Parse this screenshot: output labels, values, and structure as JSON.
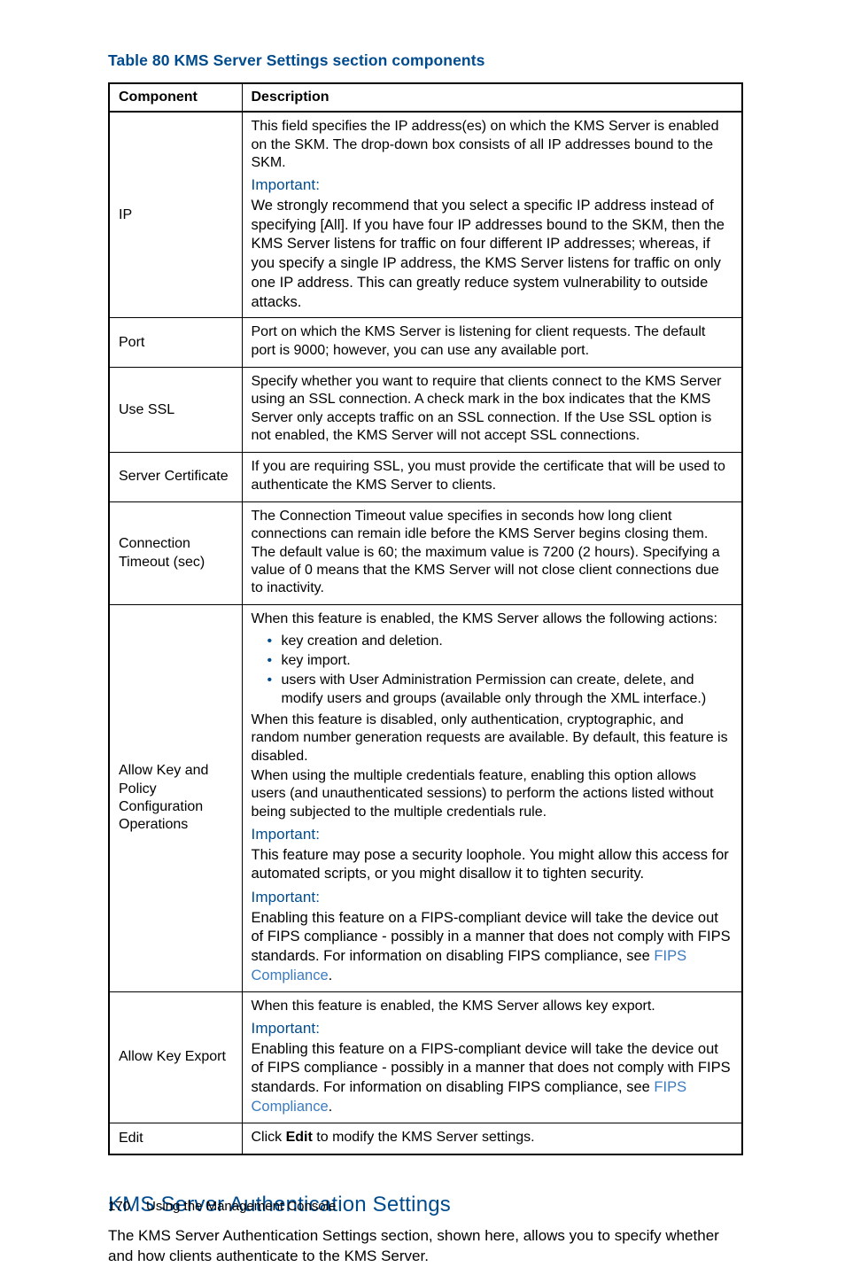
{
  "table_title": "Table 80 KMS Server Settings section components",
  "headers": {
    "c1": "Component",
    "c2": "Description"
  },
  "rows": {
    "ip": {
      "label": "IP",
      "intro": "This field specifies the IP address(es) on which the KMS Server is enabled on the SKM. The drop-down box consists of all IP addresses bound to the SKM.",
      "important": "Important:",
      "body": "We strongly recommend that you select a specific IP address instead of specifying [All]. If you have four IP addresses bound to the SKM, then the KMS Server listens for traffic on four different IP addresses; whereas, if you specify a single IP address, the KMS Server listens for traffic on only one IP address. This can greatly reduce system vulnerability to outside attacks."
    },
    "port": {
      "label": "Port",
      "body": "Port on which the KMS Server is listening for client requests. The default port is 9000; however, you can use any available port."
    },
    "ssl": {
      "label": "Use SSL",
      "body": "Specify whether you want to require that clients connect to the KMS Server using an SSL connection. A check mark in the box indicates that the KMS Server only accepts traffic on an SSL connection. If the Use SSL option is not enabled, the KMS Server will not accept SSL connections."
    },
    "cert": {
      "label": "Server Certificate",
      "body": "If you are requiring SSL, you must provide the certificate that will be used to authenticate the KMS Server to clients."
    },
    "timeout": {
      "label": "Connection Timeout (sec)",
      "body": "The Connection Timeout value specifies in seconds how long client connections can remain idle before the KMS Server begins closing them. The default value is 60; the maximum value is 7200 (2 hours). Specifying a value of 0 means that the KMS Server will not close client connections due to inactivity."
    },
    "allow_kp": {
      "label": "Allow Key and Policy Configuration Operations",
      "intro": "When this feature is enabled, the KMS Server allows the following actions:",
      "li1": "key creation and deletion.",
      "li2": "key import.",
      "li3": "users with User Administration Permission can create, delete, and modify users and groups (available only through the XML interface.)",
      "p2": "When this feature is disabled, only authentication, cryptographic, and random number generation requests are available. By default, this feature is disabled.",
      "p3": "When using the multiple credentials feature, enabling this option allows users (and unauthenticated sessions) to perform the actions listed without being subjected to the multiple credentials rule.",
      "important1": "Important:",
      "body1": "This feature may pose a security loophole. You might allow this access for automated scripts, or you might disallow it to tighten security.",
      "important2": "Important:",
      "body2a": "Enabling this feature on a FIPS-compliant device will take the device out of FIPS compliance - possibly in a manner that does not comply with FIPS standards. For information on disabling FIPS compliance, see ",
      "link2": "FIPS Compliance",
      "body2b": "."
    },
    "allow_ke": {
      "label": "Allow Key Export",
      "intro": "When this feature is enabled, the KMS Server allows key export.",
      "important": "Important:",
      "body_a": "Enabling this feature on a FIPS-compliant device will take the device out of FIPS compliance - possibly in a manner that does not comply with FIPS standards. For information on disabling FIPS compliance, see ",
      "link": "FIPS Compliance",
      "body_b": "."
    },
    "edit": {
      "label": "Edit",
      "pre": "Click ",
      "bold": "Edit",
      "post": " to modify the KMS Server settings."
    }
  },
  "section": {
    "heading": "KMS Server Authentication Settings",
    "body": "The KMS Server Authentication Settings section, shown here, allows you to specify whether and how clients authenticate to the KMS Server."
  },
  "footer": {
    "page": "170",
    "text": "Using the Management Console"
  }
}
